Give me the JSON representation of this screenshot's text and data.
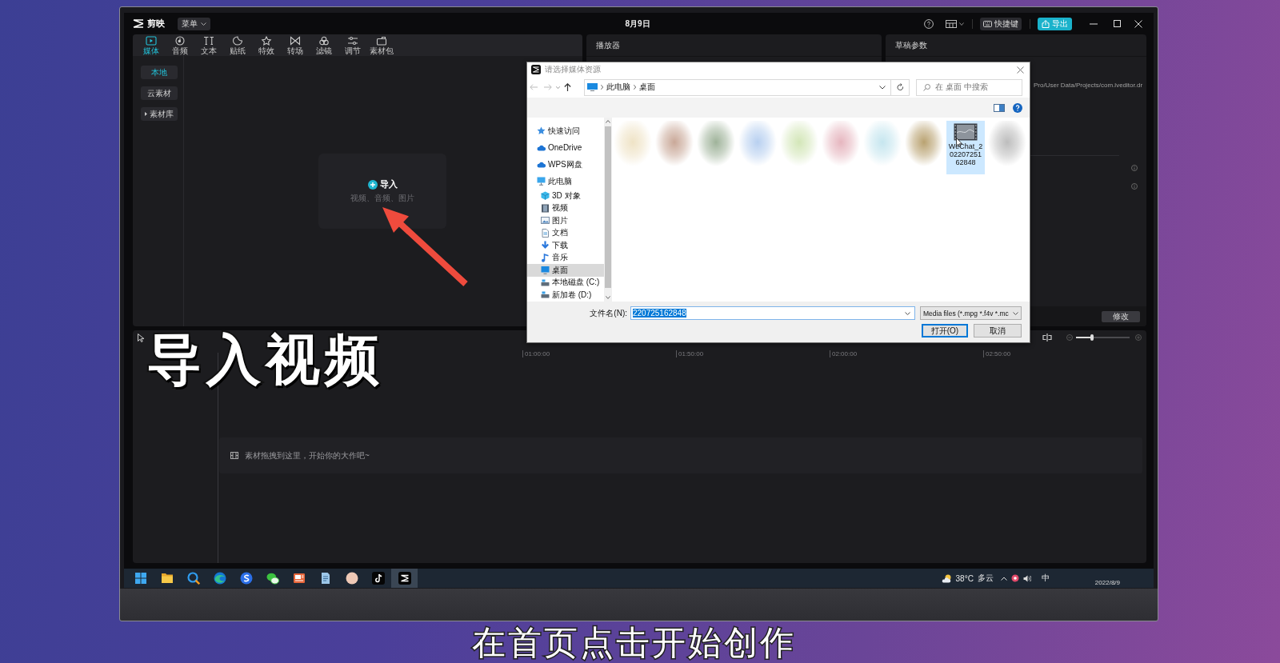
{
  "caption": "导入视频",
  "subtitle": "在首页点击开始创作",
  "app": {
    "title_bar": {
      "logo": "剪映",
      "menu": "菜单",
      "date": "8月9日",
      "shortcut_button": "快捷键",
      "export_button": "导出"
    },
    "media_panel": {
      "tabs": [
        {
          "label": "媒体",
          "kind": "media",
          "selected": true
        },
        {
          "label": "音频",
          "kind": "audio",
          "selected": false
        },
        {
          "label": "文本",
          "kind": "text",
          "selected": false
        },
        {
          "label": "贴纸",
          "kind": "sticker",
          "selected": false
        },
        {
          "label": "特效",
          "kind": "effect",
          "selected": false
        },
        {
          "label": "转场",
          "kind": "transition",
          "selected": false
        },
        {
          "label": "滤镜",
          "kind": "filter",
          "selected": false
        },
        {
          "label": "调节",
          "kind": "adjust",
          "selected": false
        },
        {
          "label": "素材包",
          "kind": "package",
          "selected": false
        }
      ],
      "sidebar": [
        {
          "label": "本地",
          "kind": "item",
          "selected": true
        },
        {
          "label": "云素材",
          "kind": "item",
          "selected": false
        },
        {
          "label": "素材库",
          "kind": "group",
          "selected": false
        }
      ],
      "import_card": {
        "label": "导入",
        "hint": "视频、音频、图片"
      }
    },
    "player_panel": {
      "title": "播放器"
    },
    "draft_panel": {
      "title": "草稿参数",
      "path": "Pro/User Data/Projects/com.lveditor.dr",
      "edit_button": "修改"
    },
    "timeline": {
      "zoom": {
        "level": 0.3
      },
      "ruler": [
        "01:00:00",
        "01:50:00",
        "02:00:00",
        "02:50:00"
      ],
      "drop_hint": "素材拖拽到这里，开始你的大作吧~"
    }
  },
  "dialog": {
    "title": "请选择媒体资源",
    "path": [
      "此电脑",
      "桌面"
    ],
    "search": {
      "placeholder": "在 桌面 中搜索"
    },
    "nav": [
      {
        "label": "快速访问",
        "kind": "star",
        "selected": false
      },
      {
        "label": "OneDrive",
        "kind": "cloud",
        "selected": false
      },
      {
        "label": "WPS网盘",
        "kind": "cloud",
        "selected": false
      },
      {
        "label": "此电脑",
        "kind": "computer",
        "selected": false,
        "children": [
          {
            "label": "3D 对象",
            "kind": "cube",
            "selected": false
          },
          {
            "label": "视频",
            "kind": "film",
            "selected": false
          },
          {
            "label": "图片",
            "kind": "image",
            "selected": false
          },
          {
            "label": "文档",
            "kind": "document",
            "selected": false
          },
          {
            "label": "下载",
            "kind": "download",
            "selected": false
          },
          {
            "label": "音乐",
            "kind": "music",
            "selected": false
          },
          {
            "label": "桌面",
            "kind": "desktop",
            "selected": true
          },
          {
            "label": "本地磁盘 (C:)",
            "kind": "disk",
            "selected": false
          },
          {
            "label": "新加卷 (D:)",
            "kind": "disk",
            "selected": false
          }
        ]
      }
    ],
    "files": [
      {
        "name": "WeChat_20220725162848",
        "selected": true
      }
    ],
    "file_name": {
      "label": "文件名(N):",
      "value": "220725162848",
      "highlighted": true
    },
    "file_type": "Media files (*.mpg *.f4v *.mc",
    "buttons": [
      {
        "label": "打开(O)",
        "focused": true
      },
      {
        "label": "取消",
        "focused": false
      }
    ]
  },
  "taskbar": {
    "apps": [
      {
        "kind": "start",
        "active": false
      },
      {
        "kind": "folder",
        "active": false
      },
      {
        "kind": "search",
        "active": false
      },
      {
        "kind": "browser",
        "active": false
      },
      {
        "kind": "input",
        "active": false
      },
      {
        "kind": "chat",
        "active": false
      },
      {
        "kind": "slides",
        "active": false
      },
      {
        "kind": "notes",
        "active": false
      },
      {
        "kind": "avatar",
        "active": false
      },
      {
        "kind": "music",
        "active": false
      },
      {
        "kind": "editor",
        "active": true
      }
    ],
    "weather": {
      "temperature": "38°C",
      "condition": "多云"
    },
    "ime": "中",
    "date": "2022/8/9"
  }
}
